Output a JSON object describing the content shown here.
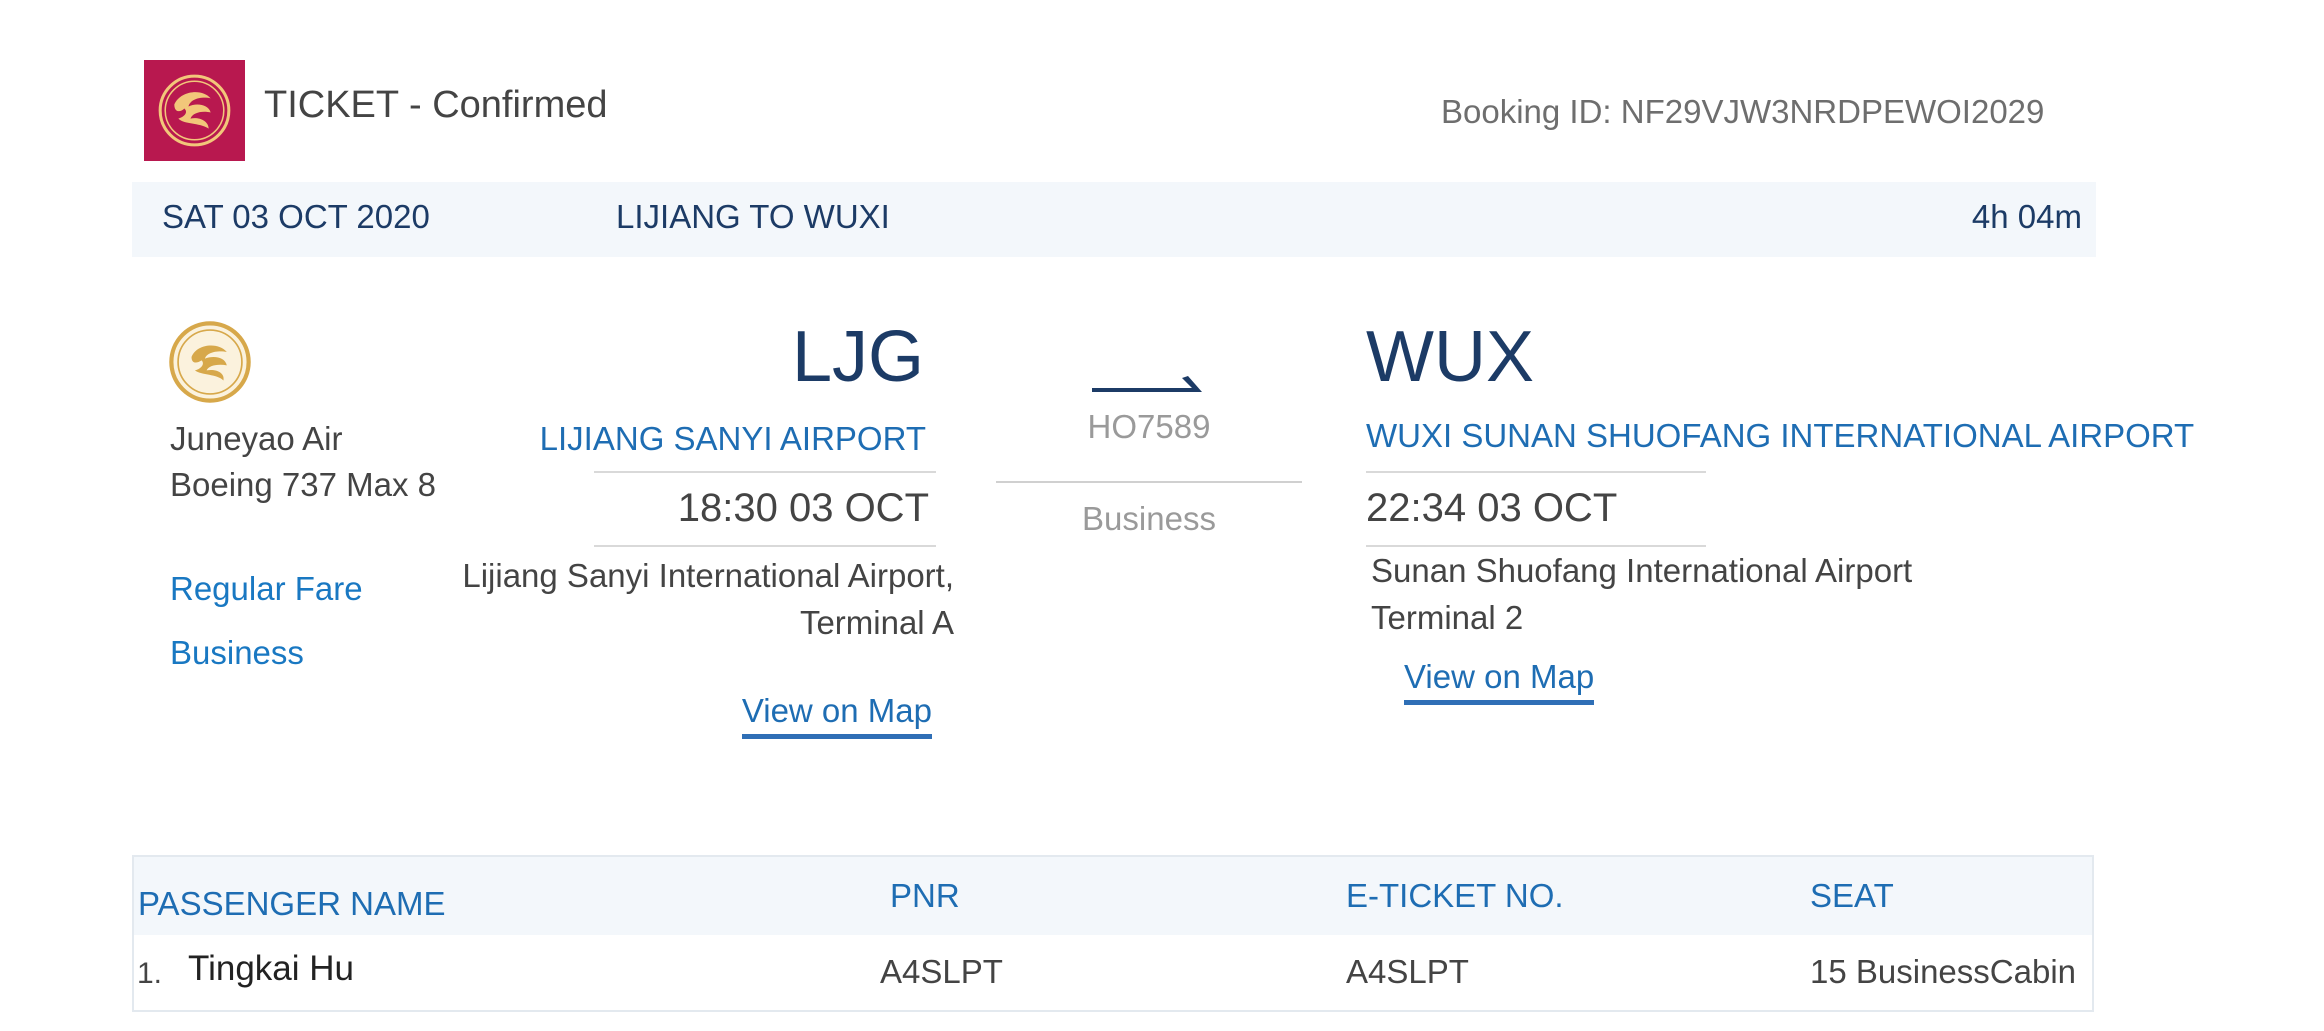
{
  "header": {
    "title": "TICKET - Confirmed",
    "booking_id": "Booking ID: NF29VJW3NRDPEWOI2029",
    "logo": "airline-phoenix-logo",
    "brand_color": "#b8184f"
  },
  "trip": {
    "date": "SAT 03 OCT 2020",
    "route": "LIJIANG TO WUXI",
    "duration": "4h 04m"
  },
  "airline": {
    "logo": "airline-phoenix-logo",
    "name": "Juneyao Air",
    "aircraft": "Boeing 737 Max 8",
    "fare": "Regular Fare",
    "cabin_class": "Business"
  },
  "departure": {
    "code": "LJG",
    "airport_name": "LIJIANG SANYI AIRPORT",
    "time": "18:30 03 OCT",
    "terminal_text": "Lijiang Sanyi International Airport, Terminal A",
    "map_link": "View on Map"
  },
  "flight": {
    "number": "HO7589",
    "cabin": "Business",
    "icon": "plane-icon"
  },
  "arrival": {
    "code": "WUX",
    "airport_name": "WUXI SUNAN SHUOFANG INTERNATIONAL AIRPORT",
    "time": "22:34 03 OCT",
    "airport_full": "Sunan Shuofang International Airport",
    "terminal": "Terminal 2",
    "map_link": "View on Map"
  },
  "passengers": {
    "headers": {
      "name": "PASSENGER NAME",
      "pnr": "PNR",
      "eticket": "E-TICKET NO.",
      "seat": "SEAT"
    },
    "rows": [
      {
        "index": "1.",
        "name": "Tingkai Hu",
        "pnr": "A4SLPT",
        "eticket": "A4SLPT",
        "seat": "15 BusinessCabin"
      }
    ]
  }
}
